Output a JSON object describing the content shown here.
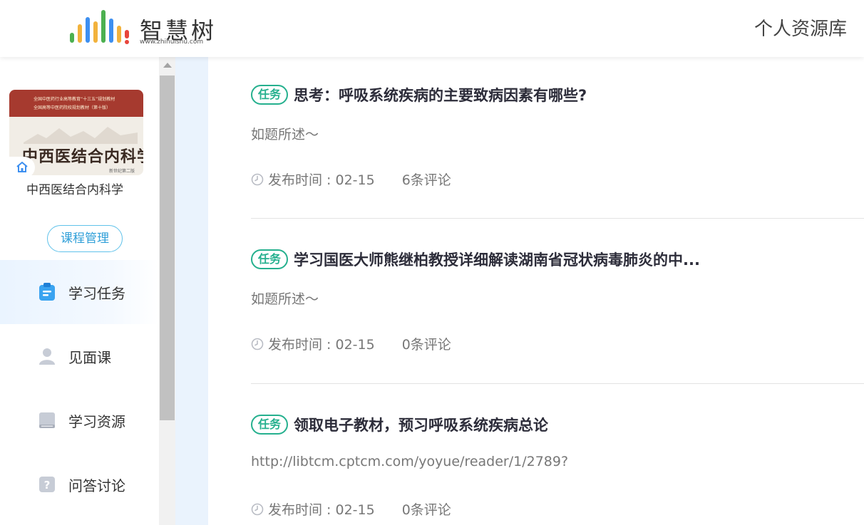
{
  "header": {
    "logo_text": "智慧树",
    "logo_url": "www.zhihuishu.com",
    "right_link": "个人资源库",
    "logo_bar_colors": [
      "#f2b23c",
      "#4cb050",
      "#3d8ff0",
      "#f2b23c",
      "#e8453c",
      "#4cb050",
      "#3d8ff0",
      "#e8453c"
    ]
  },
  "sidebar": {
    "cover": {
      "line1": "全国中医药行业高等教育“十三五”规划教材",
      "line2": "全国高等中医药院校规划教材（第十版）",
      "title": "中西医结合内科学",
      "edition": "新世纪第二版"
    },
    "course_name": "中西医结合内科学",
    "manage_label": "课程管理",
    "nav": [
      {
        "label": "学习任务",
        "icon": "clipboard-icon",
        "active": true
      },
      {
        "label": "见面课",
        "icon": "person-icon",
        "active": false
      },
      {
        "label": "学习资源",
        "icon": "book-icon",
        "active": false
      },
      {
        "label": "问答讨论",
        "icon": "question-icon",
        "active": false
      }
    ]
  },
  "tasks": [
    {
      "badge": "任务",
      "title": "思考：呼吸系统疾病的主要致病因素有哪些?",
      "desc": "如题所述～",
      "date": "发布时间 : 02-15",
      "comments": "6条评论"
    },
    {
      "badge": "任务",
      "title": "学习国医大师熊继柏教授详细解读湖南省冠状病毒肺炎的中...",
      "desc": "如题所述～",
      "date": "发布时间 : 02-15",
      "comments": "0条评论"
    },
    {
      "badge": "任务",
      "title": "领取电子教材，预习呼吸系统疾病总论",
      "desc": "http://libtcm.cptcm.com/yoyue/reader/1/2789?",
      "date": "发布时间 : 02-15",
      "comments": "0条评论"
    }
  ],
  "colors": {
    "accent_green": "#25b08e",
    "accent_blue": "#2f9fd8",
    "active_nav_bg": "#eaf4ff"
  }
}
